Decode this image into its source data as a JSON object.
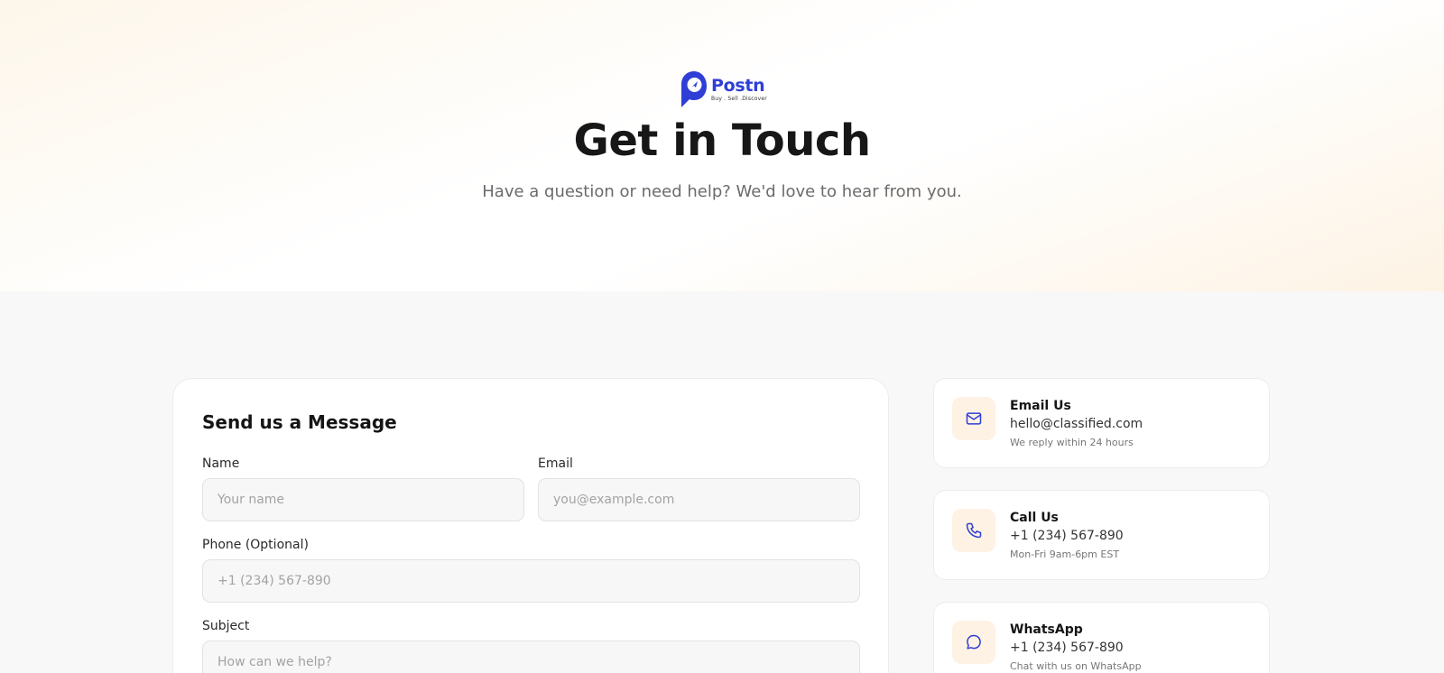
{
  "brand": {
    "name": "Postn",
    "tagline": "Buy . Sell .Discover",
    "color": "#2f3fd6"
  },
  "hero": {
    "title": "Get in Touch",
    "subtitle": "Have a question or need help? We'd love to hear from you."
  },
  "form": {
    "title": "Send us a Message",
    "name": {
      "label": "Name",
      "placeholder": "Your name"
    },
    "email": {
      "label": "Email",
      "placeholder": "you@example.com"
    },
    "phone": {
      "label": "Phone (Optional)",
      "placeholder": "+1 (234) 567-890"
    },
    "subject": {
      "label": "Subject",
      "placeholder": "How can we help?"
    }
  },
  "contacts": [
    {
      "icon": "mail-icon",
      "title": "Email Us",
      "value": "hello@classified.com",
      "note": "We reply within 24 hours"
    },
    {
      "icon": "phone-icon",
      "title": "Call Us",
      "value": "+1 (234) 567-890",
      "note": "Mon-Fri 9am-6pm EST"
    },
    {
      "icon": "chat-bubble-icon",
      "title": "WhatsApp",
      "value": "+1 (234) 567-890",
      "note": "Chat with us on WhatsApp"
    }
  ],
  "colors": {
    "accent": "#2f3fd6",
    "icon_bg": "#fdf2e3",
    "page_bg": "#f8f8f8"
  }
}
